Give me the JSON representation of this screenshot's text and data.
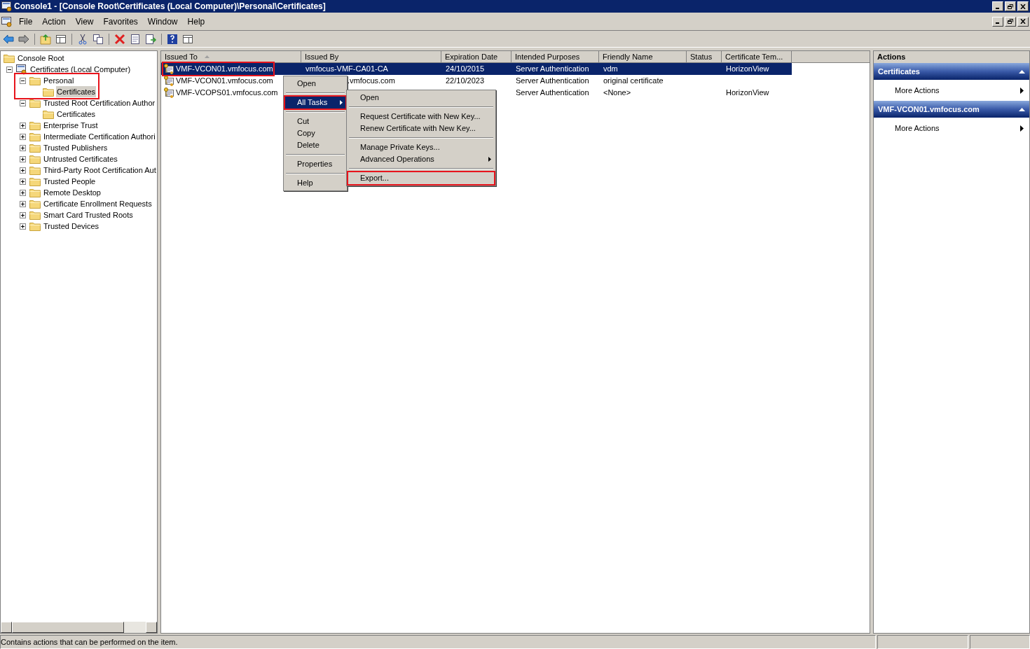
{
  "window": {
    "title": "Console1 - [Console Root\\Certificates (Local Computer)\\Personal\\Certificates]"
  },
  "menu_bar": [
    "File",
    "Action",
    "View",
    "Favorites",
    "Window",
    "Help"
  ],
  "tree": [
    {
      "label": "Console Root",
      "selected": false,
      "children": [
        {
          "label": "Certificates (Local Computer)",
          "expanded": true,
          "selected": false,
          "children": [
            {
              "label": "Personal",
              "expanded": true,
              "selected": false,
              "annotated": true,
              "children": [
                {
                  "label": "Certificates",
                  "selected": true
                }
              ]
            },
            {
              "label": "Trusted Root Certification Author",
              "expanded": true,
              "selected": false,
              "children": [
                {
                  "label": "Certificates",
                  "selected": false
                }
              ]
            },
            {
              "label": "Enterprise Trust",
              "expanded": false,
              "selected": false
            },
            {
              "label": "Intermediate Certification Authori",
              "expanded": false,
              "selected": false
            },
            {
              "label": "Trusted Publishers",
              "expanded": false,
              "selected": false
            },
            {
              "label": "Untrusted Certificates",
              "expanded": false,
              "selected": false
            },
            {
              "label": "Third-Party Root Certification Aut",
              "expanded": false,
              "selected": false
            },
            {
              "label": "Trusted People",
              "expanded": false,
              "selected": false
            },
            {
              "label": "Remote Desktop",
              "expanded": false,
              "selected": false
            },
            {
              "label": "Certificate Enrollment Requests",
              "expanded": false,
              "selected": false
            },
            {
              "label": "Smart Card Trusted Roots",
              "expanded": false,
              "selected": false
            },
            {
              "label": "Trusted Devices",
              "expanded": false,
              "selected": false
            }
          ]
        }
      ]
    }
  ],
  "table": {
    "columns": [
      {
        "label": "Issued To",
        "sorted": true
      },
      {
        "label": "Issued By",
        "sorted": false
      },
      {
        "label": "Expiration Date",
        "sorted": false
      },
      {
        "label": "Intended Purposes",
        "sorted": false
      },
      {
        "label": "Friendly Name",
        "sorted": false
      },
      {
        "label": "Status",
        "sorted": false
      },
      {
        "label": "Certificate Tem...",
        "sorted": false
      }
    ],
    "rows": [
      {
        "selected": true,
        "annotated": true,
        "cells": [
          "VMF-VCON01.vmfocus.com",
          "vmfocus-VMF-CA01-CA",
          "24/10/2015",
          "Server Authentication",
          "vdm",
          "",
          "HorizonView"
        ]
      },
      {
        "selected": false,
        "annotated": false,
        "cells": [
          "VMF-VCON01.vmfocus.com",
          ".vmfocus.com",
          "22/10/2023",
          "Server Authentication",
          "original certificate",
          "",
          ""
        ]
      },
      {
        "selected": false,
        "annotated": false,
        "cells": [
          "VMF-VCOPS01.vmfocus.com",
          "",
          "",
          "Server Authentication",
          "<None>",
          "",
          "HorizonView"
        ]
      }
    ]
  },
  "context_menu": {
    "items": [
      {
        "kind": "item",
        "label": "Open",
        "selected": false,
        "submenu": false,
        "annotated": false
      },
      {
        "kind": "separator"
      },
      {
        "kind": "item",
        "label": "All Tasks",
        "selected": true,
        "submenu": true,
        "annotated": true
      },
      {
        "kind": "separator"
      },
      {
        "kind": "item",
        "label": "Cut",
        "selected": false,
        "submenu": false,
        "annotated": false
      },
      {
        "kind": "item",
        "label": "Copy",
        "selected": false,
        "submenu": false,
        "annotated": false
      },
      {
        "kind": "item",
        "label": "Delete",
        "selected": false,
        "submenu": false,
        "annotated": false
      },
      {
        "kind": "separator"
      },
      {
        "kind": "item",
        "label": "Properties",
        "selected": false,
        "submenu": false,
        "annotated": false
      },
      {
        "kind": "separator"
      },
      {
        "kind": "item",
        "label": "Help",
        "selected": false,
        "submenu": false,
        "annotated": false
      }
    ],
    "submenu": [
      {
        "kind": "item",
        "label": "Open",
        "selected": false,
        "submenu": false,
        "annotated": false
      },
      {
        "kind": "separator"
      },
      {
        "kind": "item",
        "label": "Request Certificate with New Key...",
        "selected": false,
        "submenu": false,
        "annotated": false
      },
      {
        "kind": "item",
        "label": "Renew Certificate with New Key...",
        "selected": false,
        "submenu": false,
        "annotated": false
      },
      {
        "kind": "separator"
      },
      {
        "kind": "item",
        "label": "Manage Private Keys...",
        "selected": false,
        "submenu": false,
        "annotated": false
      },
      {
        "kind": "item",
        "label": "Advanced Operations",
        "selected": false,
        "submenu": true,
        "annotated": false
      },
      {
        "kind": "separator"
      },
      {
        "kind": "item",
        "label": "Export...",
        "selected": false,
        "submenu": false,
        "annotated": true
      }
    ]
  },
  "actions": {
    "title": "Actions",
    "sections": [
      {
        "title": "Certificates",
        "items": [
          "More Actions"
        ]
      },
      {
        "title": "VMF-VCON01.vmfocus.com",
        "items": [
          "More Actions"
        ]
      }
    ]
  },
  "status_bar": {
    "text": "Contains actions that can be performed on the item."
  }
}
